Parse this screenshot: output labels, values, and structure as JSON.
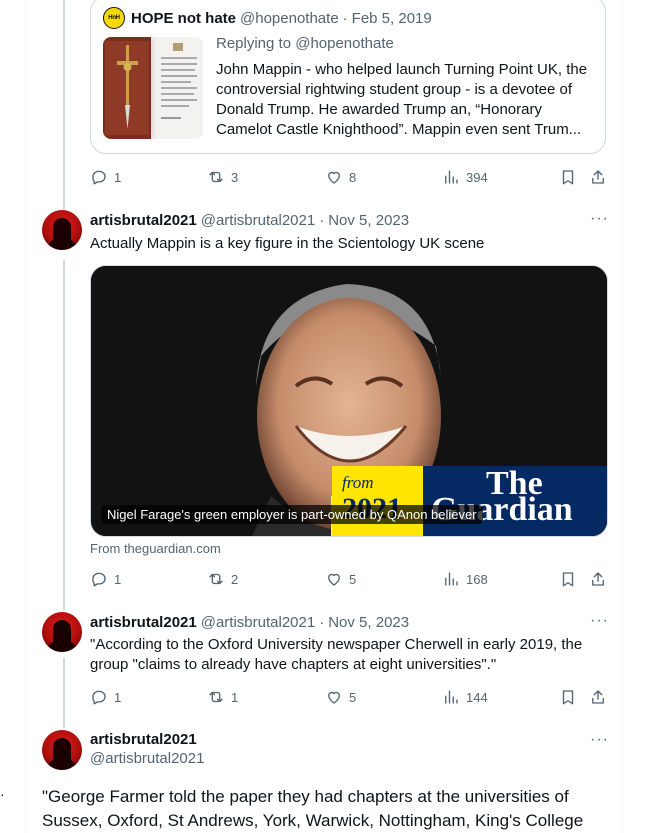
{
  "quoted_tweet": {
    "name": "HOPE not hate",
    "logo_text": "HOPE not hate",
    "handle": "@hopenothate",
    "date": "Feb 5, 2019",
    "replying_to": "Replying to @hopenothate",
    "text": "John Mappin - who helped launch Turning Point UK, the controversial rightwing student group - is a devotee of Donald Trump. He awarded Trump an, “Honorary Camelot Castle Knighthood”. Mappin even sent Trum..."
  },
  "tweets": [
    {
      "name": "artisbrutal2021",
      "handle": "@artisbrutal2021",
      "date": "Nov 5, 2023",
      "text": "",
      "stats": {
        "replies": "1",
        "reposts": "3",
        "likes": "8",
        "views": "394"
      }
    },
    {
      "name": "artisbrutal2021",
      "handle": "@artisbrutal2021",
      "date": "Nov 5, 2023",
      "text": "Actually Mappin is a key figure in the Scientology UK scene",
      "card": {
        "caption": "Nigel Farage's green employer is part-owned by QAnon believer",
        "from_label": "from",
        "year_label": "2021",
        "brand_line1": "The",
        "brand_line2": "Guardian",
        "source": "From theguardian.com"
      },
      "stats": {
        "replies": "1",
        "reposts": "2",
        "likes": "5",
        "views": "168"
      }
    },
    {
      "name": "artisbrutal2021",
      "handle": "@artisbrutal2021",
      "date": "Nov 5, 2023",
      "text": "\"According to the Oxford University newspaper Cherwell in early 2019, the group \"claims to already have chapters at eight universities\".\"",
      "stats": {
        "replies": "1",
        "reposts": "1",
        "likes": "5",
        "views": "144"
      }
    },
    {
      "name": "artisbrutal2021",
      "handle": "@artisbrutal2021",
      "text": "\"George Farmer told the paper they had chapters at the universities of Sussex, Oxford, St Andrews, York, Warwick, Nottingham, King's College"
    }
  ],
  "ui": {
    "separator": "·",
    "more_glyph": "···",
    "left_dot": "·"
  },
  "icons": [
    "reply-icon",
    "repost-icon",
    "like-icon",
    "views-icon",
    "bookmark-icon",
    "share-icon",
    "more-icon"
  ],
  "colors": {
    "text": "#0f1419",
    "muted": "#536471",
    "border": "#cfd9de",
    "guardian_blue": "#052962",
    "guardian_yellow": "#ffe500"
  }
}
